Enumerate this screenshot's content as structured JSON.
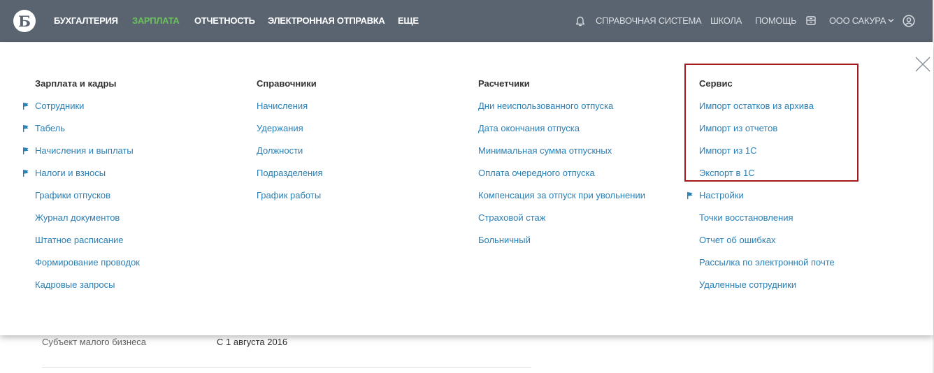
{
  "topbar": {
    "logo_letter": "Б",
    "nav": [
      {
        "label": "БУХГАЛТЕРИЯ",
        "active": false
      },
      {
        "label": "ЗАРПЛАТА",
        "active": true
      },
      {
        "label": "ОТЧЕТНОСТЬ",
        "active": false
      },
      {
        "label": "ЭЛЕКТРОННАЯ ОТПРАВКА",
        "active": false
      },
      {
        "label": "ЕЩЕ",
        "active": false
      }
    ],
    "right": {
      "help_system": "СПРАВОЧНАЯ СИСТЕМА",
      "school": "ШКОЛА",
      "help": "ПОМОЩЬ",
      "company": "ООО САКУРА"
    },
    "icons": [
      "bell-icon",
      "archive-icon",
      "chevron-down-icon",
      "user-icon"
    ],
    "colors": {
      "bar": "#5a6470",
      "active": "#6ac15b",
      "text": "#ffffff"
    }
  },
  "menu": {
    "columns": [
      {
        "title": "Зарплата и кадры",
        "items": [
          {
            "label": "Сотрудники",
            "flag": true
          },
          {
            "label": "Табель",
            "flag": true
          },
          {
            "label": "Начисления и выплаты",
            "flag": true
          },
          {
            "label": "Налоги и взносы",
            "flag": true
          },
          {
            "label": "Графики отпусков",
            "flag": false
          },
          {
            "label": "Журнал документов",
            "flag": false
          },
          {
            "label": "Штатное расписание",
            "flag": false
          },
          {
            "label": "Формирование проводок",
            "flag": false
          },
          {
            "label": "Кадровые запросы",
            "flag": false
          }
        ]
      },
      {
        "title": "Справочники",
        "items": [
          {
            "label": "Начисления",
            "flag": false
          },
          {
            "label": "Удержания",
            "flag": false
          },
          {
            "label": "Должности",
            "flag": false
          },
          {
            "label": "Подразделения",
            "flag": false
          },
          {
            "label": "График работы",
            "flag": false
          }
        ]
      },
      {
        "title": "Расчетчики",
        "items": [
          {
            "label": "Дни неиспользованного отпуска",
            "flag": false
          },
          {
            "label": "Дата окончания отпуска",
            "flag": false
          },
          {
            "label": "Минимальная сумма отпускных",
            "flag": false
          },
          {
            "label": "Оплата очередного отпуска",
            "flag": false
          },
          {
            "label": "Компенсация за отпуск при увольнении",
            "flag": false
          },
          {
            "label": "Страховой стаж",
            "flag": false
          },
          {
            "label": "Больничный",
            "flag": false
          }
        ]
      },
      {
        "title": "Сервис",
        "items": [
          {
            "label": "Импорт остатков из архива",
            "flag": false
          },
          {
            "label": "Импорт из отчетов",
            "flag": false
          },
          {
            "label": "Импорт из 1С",
            "flag": false
          },
          {
            "label": "Экспорт в 1С",
            "flag": false
          },
          {
            "label": "Настройки",
            "flag": true
          },
          {
            "label": "Точки восстановления",
            "flag": false
          },
          {
            "label": "Отчет об ошибках",
            "flag": false
          },
          {
            "label": "Рассылка по электронной почте",
            "flag": false
          },
          {
            "label": "Удаленные сотрудники",
            "flag": false
          }
        ]
      }
    ],
    "colors": {
      "link": "#2a7fb5",
      "heading": "#333333",
      "flag": "#2a7fb5",
      "highlight": "#a41a1a"
    },
    "close_icon": "close-icon"
  },
  "background": {
    "row_label": "Субъект малого бизнеса",
    "row_value": "С 1 августа 2016"
  }
}
